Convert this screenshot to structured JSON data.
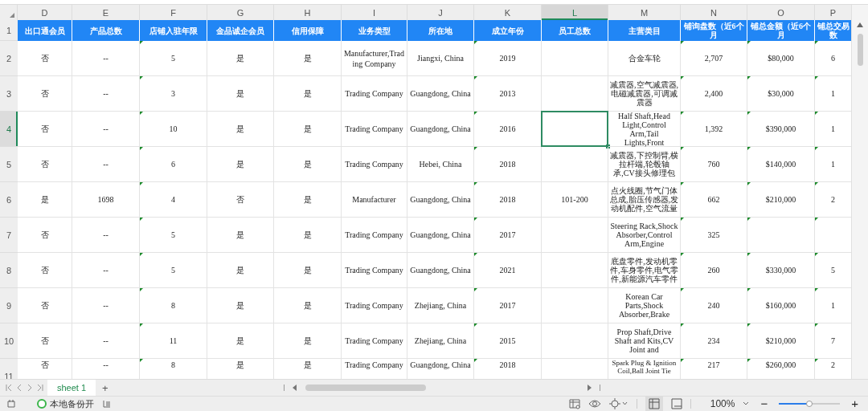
{
  "columns": [
    {
      "letter": "D",
      "header": "出口通会员",
      "selected": false,
      "flagged": false
    },
    {
      "letter": "E",
      "header": "产品总数",
      "selected": false,
      "flagged": false
    },
    {
      "letter": "F",
      "header": "店铺入驻年限",
      "selected": false,
      "flagged": true
    },
    {
      "letter": "G",
      "header": "金品诚企会员",
      "selected": false,
      "flagged": false
    },
    {
      "letter": "H",
      "header": "信用保障",
      "selected": false,
      "flagged": false
    },
    {
      "letter": "I",
      "header": "业务类型",
      "selected": false,
      "flagged": false
    },
    {
      "letter": "J",
      "header": "所在地",
      "selected": false,
      "flagged": false
    },
    {
      "letter": "K",
      "header": "成立年份",
      "selected": false,
      "flagged": true
    },
    {
      "letter": "L",
      "header": "员工总数",
      "selected": true,
      "flagged": false
    },
    {
      "letter": "M",
      "header": "主营类目",
      "selected": false,
      "flagged": false
    },
    {
      "letter": "N",
      "header": "铺询盘数（近6个月",
      "selected": false,
      "flagged": true
    },
    {
      "letter": "O",
      "header": "铺总金额（近6个月",
      "selected": false,
      "flagged": true
    },
    {
      "letter": "P",
      "header": "铺总交易数",
      "selected": false,
      "flagged": true
    }
  ],
  "header_row": "1",
  "rows": [
    {
      "number": "2",
      "selected": false,
      "cells": [
        "否",
        "--",
        "5",
        "是",
        "是",
        "Manufacturer,Trading Company",
        "Jiangxi, China",
        "2019",
        "",
        "合金车轮",
        "2,707",
        "$80,000",
        "6"
      ]
    },
    {
      "number": "3",
      "selected": false,
      "cells": [
        "否",
        "--",
        "3",
        "是",
        "是",
        "Trading Company",
        "Guangdong, China",
        "2013",
        "",
        "减震器,空气减震器,电磁减震器,可调减震器",
        "2,400",
        "$30,000",
        "1"
      ]
    },
    {
      "number": "4",
      "selected": true,
      "cells": [
        "否",
        "--",
        "10",
        "是",
        "是",
        "Trading Company",
        "Guangdong, China",
        "2016",
        "",
        "Half Shaft,Head Light,Control Arm,Tail Lights,Front",
        "1,392",
        "$390,000",
        "1"
      ]
    },
    {
      "number": "5",
      "selected": false,
      "cells": [
        "否",
        "--",
        "6",
        "是",
        "是",
        "Trading Company",
        "Hebei, China",
        "2018",
        "",
        "减震器,下控制臂,横拉杆端,轮毂轴承,CV接头修理包",
        "760",
        "$140,000",
        "1"
      ]
    },
    {
      "number": "6",
      "selected": false,
      "cells": [
        "是",
        "1698",
        "4",
        "否",
        "是",
        "Manufacturer",
        "Guangdong, China",
        "2018",
        "101-200",
        "点火线圈,节气门体总成,胎压传感器,发动机配件,空气流量",
        "662",
        "$210,000",
        "2"
      ]
    },
    {
      "number": "7",
      "selected": false,
      "cells": [
        "否",
        "--",
        "5",
        "是",
        "是",
        "Trading Company",
        "Guangdong, China",
        "2017",
        "",
        "Steering Rack,Shock Absorber,Control Arm,Engine",
        "325",
        "",
        ""
      ]
    },
    {
      "number": "8",
      "selected": false,
      "cells": [
        "否",
        "--",
        "5",
        "是",
        "是",
        "Trading Company",
        "Guangdong, China",
        "2021",
        "",
        "底盘零件,发动机零件,车身零件,电气零件,新能源汽车零件",
        "260",
        "$330,000",
        "5"
      ]
    },
    {
      "number": "9",
      "selected": false,
      "cells": [
        "否",
        "--",
        "8",
        "是",
        "是",
        "Trading Company",
        "Zhejiang, China",
        "2017",
        "",
        "Korean Car Parts,Shock Absorber,Brake",
        "240",
        "$160,000",
        "1"
      ]
    },
    {
      "number": "10",
      "selected": false,
      "cells": [
        "否",
        "--",
        "11",
        "是",
        "是",
        "Trading Company",
        "Zhejiang, China",
        "2015",
        "",
        "Prop Shaft,Drive Shaft and Kits,CV Joint and",
        "234",
        "$210,000",
        "7"
      ]
    },
    {
      "number": "11",
      "selected": false,
      "cells": [
        "否",
        "--",
        "8",
        "是",
        "是",
        "Trading Company",
        "Guangdong, China",
        "2018",
        "",
        "Spark Plug & Ignition Coil,Ball Joint Tie",
        "217",
        "$260,000",
        "2"
      ]
    }
  ],
  "sheet_tabs": [
    {
      "label": "sheet 1",
      "selected": true
    }
  ],
  "add_sheet": "+",
  "status_bar": {
    "backup": "本地备份开",
    "zoom": "100%",
    "zoom_out": "−",
    "zoom_in": "+",
    "zoom_slider": {
      "level": 0.5
    }
  }
}
